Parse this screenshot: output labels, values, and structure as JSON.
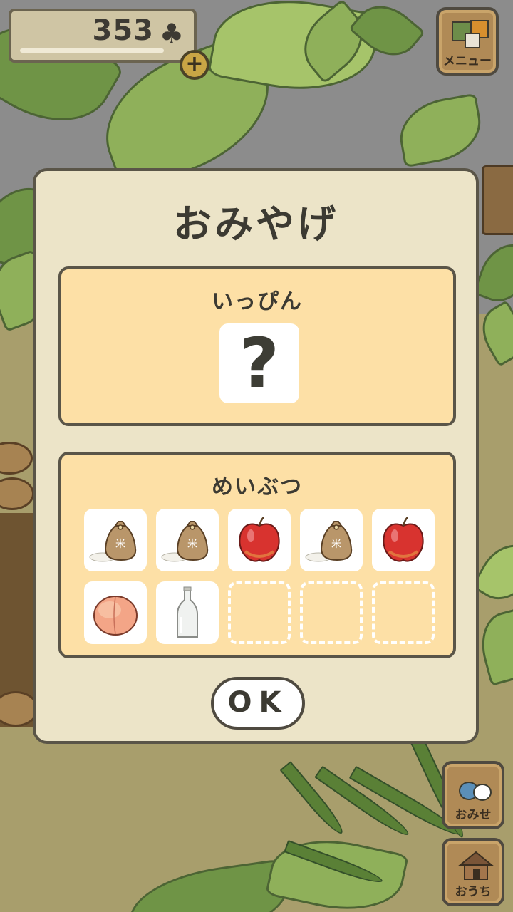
{
  "hud": {
    "clover_count": "353",
    "clover_icon": "♣",
    "add_icon": "+"
  },
  "menu_button": {
    "label": "メニュー",
    "icon": "menu-squares-icon"
  },
  "shop_button": {
    "label": "おみせ",
    "icon": "shop-bag-icon"
  },
  "home_button": {
    "label": "おうち",
    "icon": "house-icon"
  },
  "dialog": {
    "title": "おみやげ",
    "specialty": {
      "title": "いっぴん",
      "mystery_symbol": "?"
    },
    "local_goods": {
      "title": "めいぶつ",
      "items": [
        {
          "kind": "rice-bag"
        },
        {
          "kind": "rice-bag"
        },
        {
          "kind": "apple"
        },
        {
          "kind": "rice-bag"
        },
        {
          "kind": "apple"
        },
        {
          "kind": "peach"
        },
        {
          "kind": "bottle"
        },
        {
          "kind": "empty"
        },
        {
          "kind": "empty"
        },
        {
          "kind": "empty"
        }
      ]
    },
    "ok_label": "OK"
  }
}
